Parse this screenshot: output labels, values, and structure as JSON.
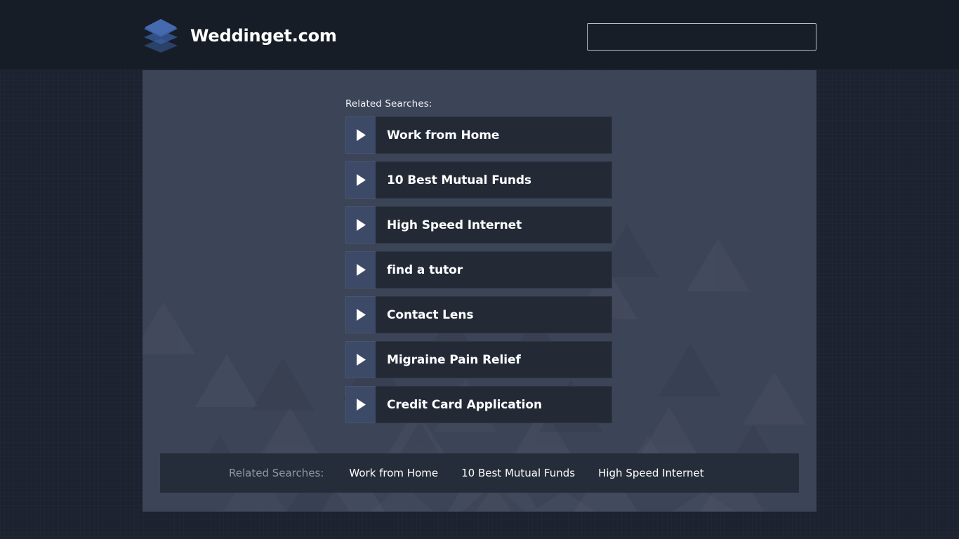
{
  "header": {
    "brand_name": "Weddinget.com",
    "logo_icon": "stacked-layers-icon",
    "search": {
      "value": "",
      "placeholder": ""
    }
  },
  "main": {
    "related_heading": "Related Searches:",
    "arrow_icon": "play-triangle-icon",
    "items": [
      {
        "label": "Work from Home"
      },
      {
        "label": "10 Best Mutual Funds"
      },
      {
        "label": "High Speed Internet"
      },
      {
        "label": "find a tutor"
      },
      {
        "label": "Contact Lens"
      },
      {
        "label": "Migraine Pain Relief"
      },
      {
        "label": "Credit Card Application"
      }
    ]
  },
  "footer": {
    "label": "Related Searches:",
    "links": [
      {
        "label": "Work from Home"
      },
      {
        "label": "10 Best Mutual Funds"
      },
      {
        "label": "High Speed Internet"
      }
    ]
  },
  "colors": {
    "page_background": "#1c2230",
    "header_background": "#161d26",
    "panel_background": "#3c4458",
    "item_arrow_background": "#3d4a67",
    "item_label_background": "#232a36",
    "footer_background": "#262d3a",
    "footer_label_text": "#8e97ab",
    "logo_blue": "#3a5a9b",
    "text_primary": "#ffffff"
  }
}
